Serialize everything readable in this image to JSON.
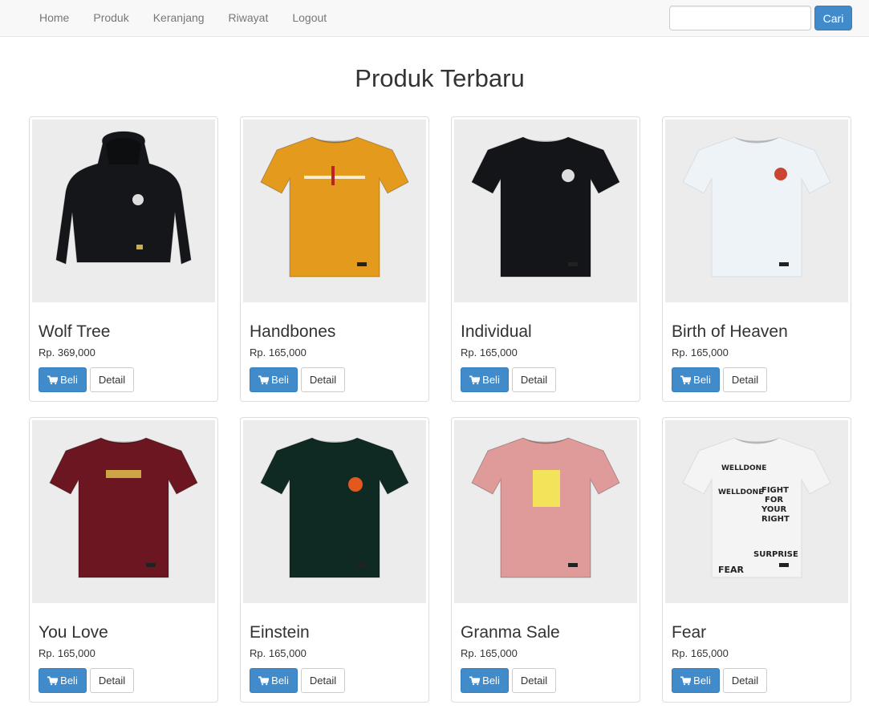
{
  "nav": {
    "links": [
      "Home",
      "Produk",
      "Keranjang",
      "Riwayat",
      "Logout"
    ],
    "search_placeholder": "",
    "search_button": "Cari"
  },
  "page_title": "Produk Terbaru",
  "buttons": {
    "buy": "Beli",
    "detail": "Detail"
  },
  "colors": {
    "primary": "#428bca",
    "navbar_bg": "#f8f8f8",
    "image_bg": "#ececec"
  },
  "products": [
    {
      "name": "Wolf Tree",
      "price": "Rp. 369,000",
      "garment": "hoodie",
      "color": "#15161a"
    },
    {
      "name": "Handbones",
      "price": "Rp. 165,000",
      "garment": "tshirt",
      "color": "#e39a1d"
    },
    {
      "name": "Individual",
      "price": "Rp. 165,000",
      "garment": "tshirt",
      "color": "#141519"
    },
    {
      "name": "Birth of Heaven",
      "price": "Rp. 165,000",
      "garment": "tshirt",
      "color": "#eef3f7"
    },
    {
      "name": "You Love",
      "price": "Rp. 165,000",
      "garment": "tshirt",
      "color": "#6b1620"
    },
    {
      "name": "Einstein",
      "price": "Rp. 165,000",
      "garment": "tshirt",
      "color": "#0f2a22"
    },
    {
      "name": "Granma Sale",
      "price": "Rp. 165,000",
      "garment": "tshirt",
      "color": "#df9a9a"
    },
    {
      "name": "Fear",
      "price": "Rp. 165,000",
      "garment": "tshirt",
      "color": "#f4f4f4"
    }
  ]
}
